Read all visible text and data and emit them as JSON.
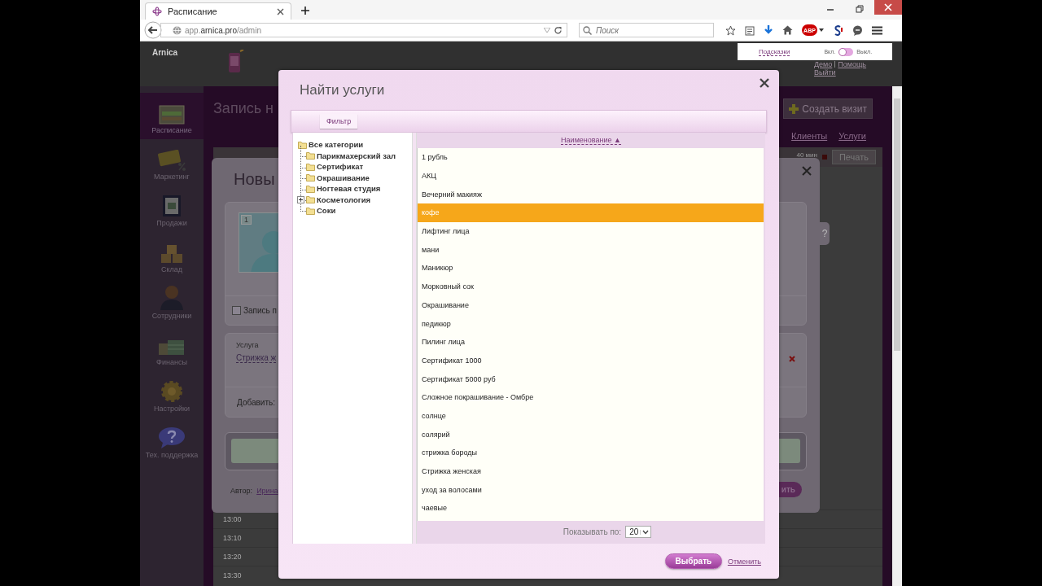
{
  "browser": {
    "tab_title": "Расписание",
    "url": "app.**arnica.pro**/admin",
    "search_placeholder": "Поиск",
    "adblock_badge": "ABP"
  },
  "app": {
    "brand": "Arnica",
    "hints": {
      "label": "Подсказки",
      "on_label": "Вкл.",
      "off_label": "Выкл.",
      "on": false
    },
    "user_links": [
      "Демо",
      "Помощь",
      "Выйти"
    ],
    "nav": [
      {
        "label": "Расписание",
        "selected": true
      },
      {
        "label": "Маркетинг",
        "selected": false
      },
      {
        "label": "Продажи",
        "selected": false
      },
      {
        "label": "Склад",
        "selected": false
      },
      {
        "label": "Сотрудники",
        "selected": false
      },
      {
        "label": "Финансы",
        "selected": false
      },
      {
        "label": "Настройки",
        "selected": false
      },
      {
        "label": "Тех. поддержка",
        "selected": false
      }
    ],
    "page_title": "Запись н",
    "create_button": "Создать визит",
    "links": [
      "Клиенты",
      "Услуги"
    ],
    "duration": "40 мин",
    "print_button": "Печать",
    "times": [
      "13:00",
      "13:10",
      "13:20",
      "13:30"
    ]
  },
  "visit_dialog": {
    "title": "Новы",
    "photo_number": "1",
    "checkbox_label": "Запись п",
    "checked": false,
    "service_label": "Услуга",
    "service_value": "Стрижка ж",
    "add_label": "Добавить:",
    "author_label": "Автор:",
    "author": "Ирина",
    "help_tab": "?",
    "save_button": "ить"
  },
  "modal": {
    "title": "Найти услуги",
    "filter_button": "Фильтр",
    "tree": {
      "label": "Все категории",
      "expanded": true,
      "children": [
        {
          "label": "Парикмахерский зал",
          "collapsed": false
        },
        {
          "label": "Сертификат",
          "collapsed": false
        },
        {
          "label": "Окрашивание",
          "collapsed": false
        },
        {
          "label": "Ногтевая студия",
          "collapsed": false
        },
        {
          "label": "Косметология",
          "collapsed": true
        },
        {
          "label": "Соки",
          "collapsed": false
        }
      ]
    },
    "column": "Наименование ▲",
    "rows": [
      {
        "name": "1 рубль",
        "selected": false
      },
      {
        "name": "АКЦ",
        "selected": false
      },
      {
        "name": "Вечерний макияж",
        "selected": false
      },
      {
        "name": "кофе",
        "selected": true
      },
      {
        "name": "Лифтинг лица",
        "selected": false
      },
      {
        "name": "мани",
        "selected": false
      },
      {
        "name": "Маникюр",
        "selected": false
      },
      {
        "name": "Морковный сок",
        "selected": false
      },
      {
        "name": "Окрашивание",
        "selected": false
      },
      {
        "name": "педикюр",
        "selected": false
      },
      {
        "name": "Пилинг лица",
        "selected": false
      },
      {
        "name": "Сертификат 1000",
        "selected": false
      },
      {
        "name": "Сертификат 5000 руб",
        "selected": false
      },
      {
        "name": "Сложное покрашивание - Омбре",
        "selected": false
      },
      {
        "name": "солнце",
        "selected": false
      },
      {
        "name": "солярий",
        "selected": false
      },
      {
        "name": "стрижка бороды",
        "selected": false
      },
      {
        "name": "Стрижка женская",
        "selected": false
      },
      {
        "name": "уход за волосами",
        "selected": false
      },
      {
        "name": "чаевые",
        "selected": false
      }
    ],
    "page_size_label": "Показывать по:",
    "page_size": "20",
    "select_button": "Выбрать",
    "cancel_link": "Отменить"
  }
}
